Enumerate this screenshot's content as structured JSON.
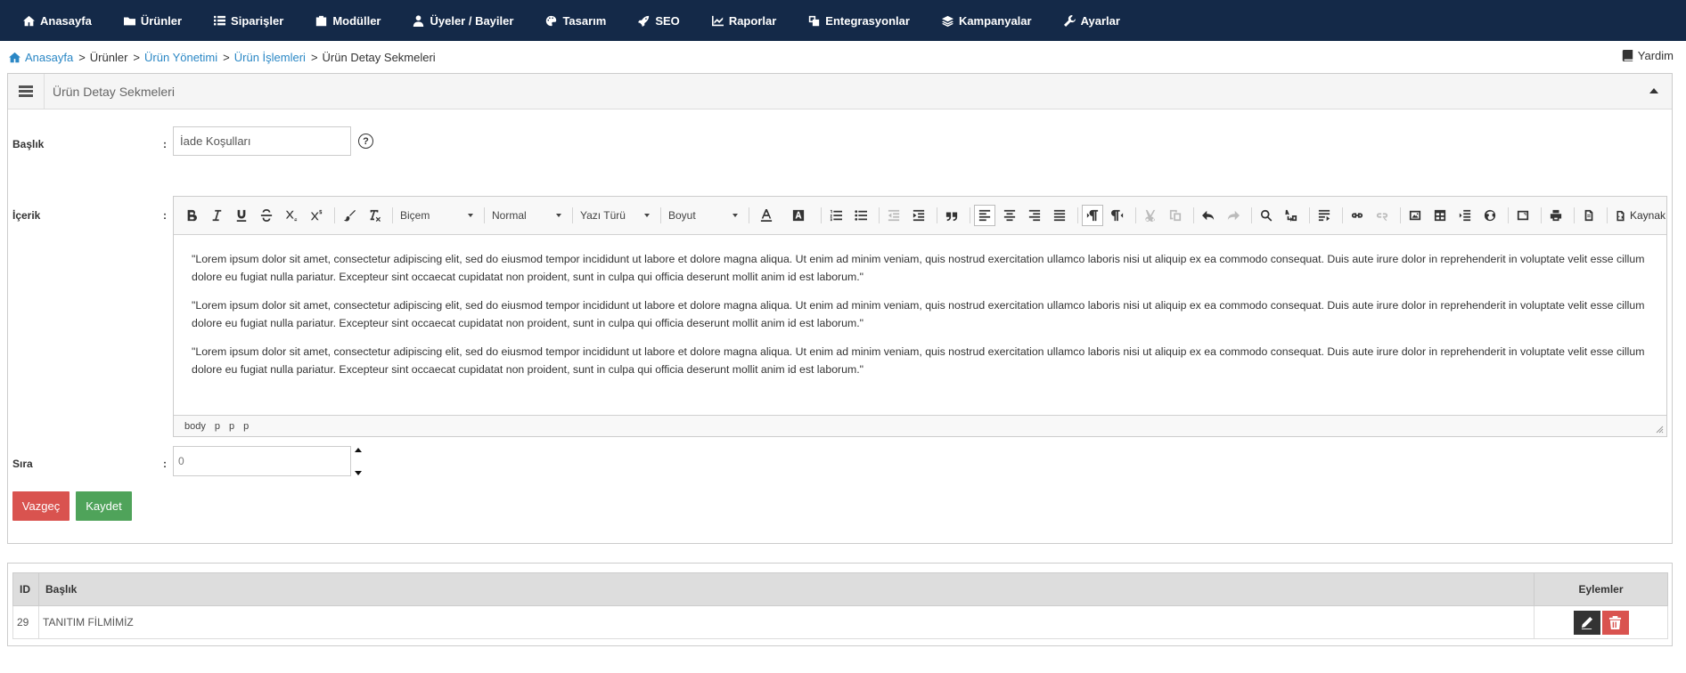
{
  "nav": [
    {
      "label": "Anasayfa",
      "icon": "home-icon"
    },
    {
      "label": "Ürünler",
      "icon": "folder-icon"
    },
    {
      "label": "Siparişler",
      "icon": "list-icon"
    },
    {
      "label": "Modüller",
      "icon": "module-icon"
    },
    {
      "label": "Üyeler / Bayiler",
      "icon": "user-icon"
    },
    {
      "label": "Tasarım",
      "icon": "palette-icon"
    },
    {
      "label": "SEO",
      "icon": "rocket-icon"
    },
    {
      "label": "Raporlar",
      "icon": "chart-icon"
    },
    {
      "label": "Entegrasyonlar",
      "icon": "integration-icon"
    },
    {
      "label": "Kampanyalar",
      "icon": "layers-icon"
    },
    {
      "label": "Ayarlar",
      "icon": "wrench-icon"
    }
  ],
  "breadcrumb": {
    "home": "Anasayfa",
    "products": "Ürünler",
    "product_management": "Ürün Yönetimi",
    "product_operations": "Ürün İşlemleri",
    "current": "Ürün Detay Sekmeleri",
    "separator": ">"
  },
  "help_label": "Yardim",
  "panel": {
    "title": "Ürün Detay Sekmeleri"
  },
  "form": {
    "colon": ":",
    "title_label": "Başlık",
    "title_value": "İade Koşulları",
    "help_glyph": "?",
    "content_label": "İçerik",
    "order_label": "Sıra",
    "order_value": "0",
    "cancel_label": "Vazgeç",
    "save_label": "Kaydet"
  },
  "editor": {
    "combo_style": "Biçem",
    "combo_format": "Normal",
    "combo_font": "Yazı Türü",
    "combo_size": "Boyut",
    "source_label": "Kaynak",
    "paragraphs": [
      "\"Lorem ipsum dolor sit amet, consectetur adipiscing elit, sed do eiusmod tempor incididunt ut labore et dolore magna aliqua. Ut enim ad minim veniam, quis nostrud exercitation ullamco laboris nisi ut aliquip ex ea commodo consequat. Duis aute irure dolor in reprehenderit in voluptate velit esse cillum dolore eu fugiat nulla pariatur. Excepteur sint occaecat cupidatat non proident, sunt in culpa qui officia deserunt mollit anim id est laborum.\"",
      "\"Lorem ipsum dolor sit amet, consectetur adipiscing elit, sed do eiusmod tempor incididunt ut labore et dolore magna aliqua. Ut enim ad minim veniam, quis nostrud exercitation ullamco laboris nisi ut aliquip ex ea commodo consequat. Duis aute irure dolor in reprehenderit in voluptate velit esse cillum dolore eu fugiat nulla pariatur. Excepteur sint occaecat cupidatat non proident, sunt in culpa qui officia deserunt mollit anim id est laborum.\"",
      "\"Lorem ipsum dolor sit amet, consectetur adipiscing elit, sed do eiusmod tempor incididunt ut labore et dolore magna aliqua. Ut enim ad minim veniam, quis nostrud exercitation ullamco laboris nisi ut aliquip ex ea commodo consequat. Duis aute irure dolor in reprehenderit in voluptate velit esse cillum dolore eu fugiat nulla pariatur. Excepteur sint occaecat cupidatat non proident, sunt in culpa qui officia deserunt mollit anim id est laborum.\""
    ],
    "path": [
      "body",
      "p",
      "p",
      "p"
    ]
  },
  "table": {
    "headers": {
      "id": "ID",
      "title": "Başlık",
      "actions": "Eylemler"
    },
    "rows": [
      {
        "id": "29",
        "title": "TANITIM FİLMİMİZ"
      }
    ]
  },
  "colors": {
    "nav_bg": "#142948",
    "link": "#2a87c5",
    "cancel": "#d9534f",
    "save": "#4fa35a"
  }
}
